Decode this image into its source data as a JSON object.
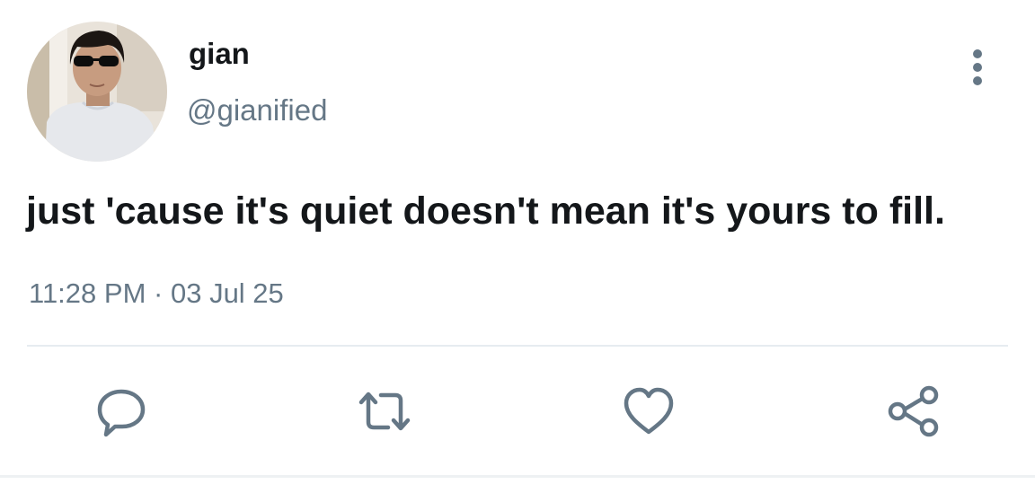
{
  "tweet": {
    "display_name": "gian",
    "handle": "@gianified",
    "text": "just 'cause it's quiet doesn't mean it's yours to fill.",
    "time": "11:28 PM",
    "separator": "·",
    "date": "03 Jul 25"
  },
  "icons": {
    "avatar": "profile-photo",
    "more": "vertical-ellipsis-icon",
    "reply": "speech-bubble-icon",
    "retweet": "retweet-arrows-icon",
    "like": "heart-icon",
    "share": "share-nodes-icon"
  },
  "colors": {
    "text_primary": "#14171a",
    "text_secondary": "#657786",
    "icon": "#657786",
    "divider": "#e6ecf0"
  }
}
